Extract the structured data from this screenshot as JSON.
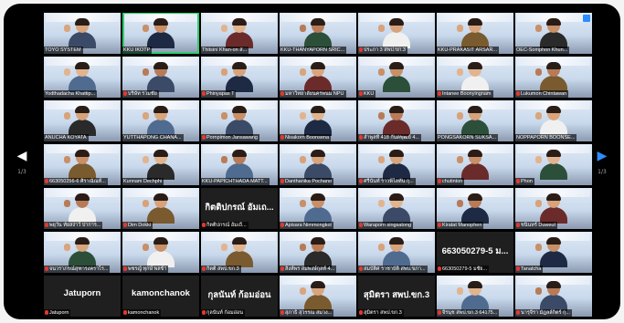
{
  "nav": {
    "prev_icon": "chevron-left-icon",
    "next_icon": "chevron-right-icon",
    "left_page": "1/3",
    "right_page": "1/3"
  },
  "participants": [
    {
      "name": "TOYO SYSTEM",
      "mic": false
    },
    {
      "name": "KKU IKOTP",
      "mic": false,
      "active": true
    },
    {
      "name": "Thitsini Khan-on ส...",
      "mic": false
    },
    {
      "name": "KKU-THANYAPORN SRIC...",
      "mic": false
    },
    {
      "name": "ประภา 3 สพป.ขก.3",
      "mic": true
    },
    {
      "name": "KKU-PRAKASIT ARSAR...",
      "mic": false
    },
    {
      "name": "OEC-Somphon Khun...",
      "mic": false
    },
    {
      "name": "Yodthadacha Khattip...",
      "mic": false
    },
    {
      "name": "บริษัท รวมชัย",
      "mic": true
    },
    {
      "name": "Phinyapas T",
      "mic": true
    },
    {
      "name": "มหาวิทยาลัยนครพนม NPU",
      "mic": true
    },
    {
      "name": "KKU",
      "mic": true
    },
    {
      "name": "Intanee Boonyingnam",
      "mic": true
    },
    {
      "name": "Lukumon Chintawan",
      "mic": true
    },
    {
      "name": "ANUCHA KOYATA",
      "mic": false
    },
    {
      "name": "YUTTHAPONG CHANA...",
      "mic": false
    },
    {
      "name": "Pornpimon Jansawang",
      "mic": true
    },
    {
      "name": "Nisakorn Boonsena",
      "mic": true
    },
    {
      "name": "ลำพูลที่ 418 กันตพุฒย์ 4...",
      "mic": true
    },
    {
      "name": "PONGSAKORN SUKSA...",
      "mic": false
    },
    {
      "name": "NOPPAPORN BOONSE...",
      "mic": false
    },
    {
      "name": "663050256-6 ศิราณัณท์...",
      "mic": true
    },
    {
      "name": "Kunnam Dechphi",
      "mic": false
    },
    {
      "name": "KKU-PAPICHTHADA MATT...",
      "mic": false
    },
    {
      "name": "Danthanika Pochano",
      "mic": true
    },
    {
      "name": "ศรีนันท์ ราวพิไลทัน กุ...",
      "mic": true
    },
    {
      "name": "chutinton",
      "mic": true
    },
    {
      "name": "Phon",
      "mic": true
    },
    {
      "name": "พยุวัน ทัยสง่าว์ ปาการ...",
      "mic": true
    },
    {
      "name": "Dim Dokki",
      "mic": true
    },
    {
      "name": "กิตติปกรณ์ อัมเถี...",
      "mic": true,
      "big": "กิตติปกรณ์ อัมเถ..."
    },
    {
      "name": "Apisara Nimmongkol",
      "mic": true
    },
    {
      "name": "Waraporn singsatong",
      "mic": true
    },
    {
      "name": "Kiratat Manophen",
      "mic": true
    },
    {
      "name": "ชนินทร์ Duweut",
      "mic": true
    },
    {
      "name": "จนวราภรณ์สุฑารงคราไร...",
      "mic": true
    },
    {
      "name": "พชรญ์ ทุกษ์ พลข้า",
      "mic": true
    },
    {
      "name": "กิตติ สพป.ขก.3",
      "mic": true
    },
    {
      "name": "สิงห์พร สมพงษ์กุลท์ 4...",
      "mic": true
    },
    {
      "name": "สมบัติศ ราชาบัติ สพบ.ขภา...",
      "mic": true
    },
    {
      "name": "663050279-5 มชัย...",
      "mic": true,
      "big": "663050279-5 ม..."
    },
    {
      "name": "Tanatcha",
      "mic": true
    },
    {
      "name": "Jatuporn",
      "mic": true,
      "big": "Jatuporn"
    },
    {
      "name": "kamonchanok",
      "mic": true,
      "big": "kamonchanok"
    },
    {
      "name": "กุลนันท์ ก้อมอ่อน",
      "mic": true,
      "big": "กุลนันท์ ก้อมอ่อน"
    },
    {
      "name": "สุภาธิ สุวรรณ สมวง...",
      "mic": true
    },
    {
      "name": "สุมิตรา สพป.ขก.3",
      "mic": true,
      "big": "สุมิตรา สพป.ขก.3"
    },
    {
      "name": "จีรนุช สพป.ขก.3 64175...",
      "mic": true
    },
    {
      "name": "นารุจีรา มัฎลล์กิตร์ กุ...",
      "mic": true
    }
  ]
}
